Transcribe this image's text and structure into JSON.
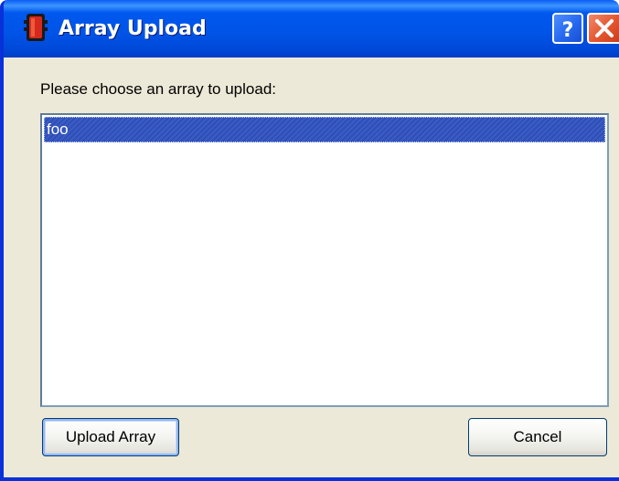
{
  "window": {
    "title": "Array Upload",
    "icon": "app-icon",
    "help_icon": "help-icon",
    "close_icon": "close-icon",
    "colors": {
      "titlebar": "#0054E3",
      "window_bg": "#ECE9D8",
      "selection": "#316AC5",
      "close_button": "#E4572F"
    }
  },
  "dialog": {
    "prompt": "Please choose an array to upload:",
    "list": {
      "items": [
        {
          "label": "foo",
          "selected": true
        }
      ]
    },
    "buttons": {
      "upload_label": "Upload Array",
      "cancel_label": "Cancel"
    }
  }
}
